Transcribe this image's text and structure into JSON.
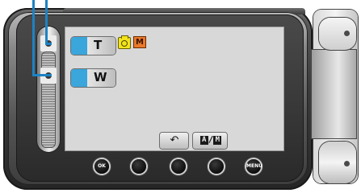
{
  "lcd": {
    "zoom_tele_label": "T",
    "zoom_wide_label": "W",
    "scene_icon_glyph": "M",
    "return_glyph": "↶",
    "am_glyph_a": "A",
    "am_glyph_sep": "/",
    "am_glyph_m": "M"
  },
  "operation_buttons": {
    "ok_label": "OK",
    "menu_label": "MENU"
  },
  "icons": {
    "camera_mode": "camera-icon",
    "scene_mode": "scene-icon",
    "return": "return-icon"
  },
  "colors": {
    "zoom_button_accent": "#3aa6dc",
    "callout_line": "#1d83c4",
    "camera_icon": "#f2e31d",
    "scene_icon": "#e9782a"
  }
}
